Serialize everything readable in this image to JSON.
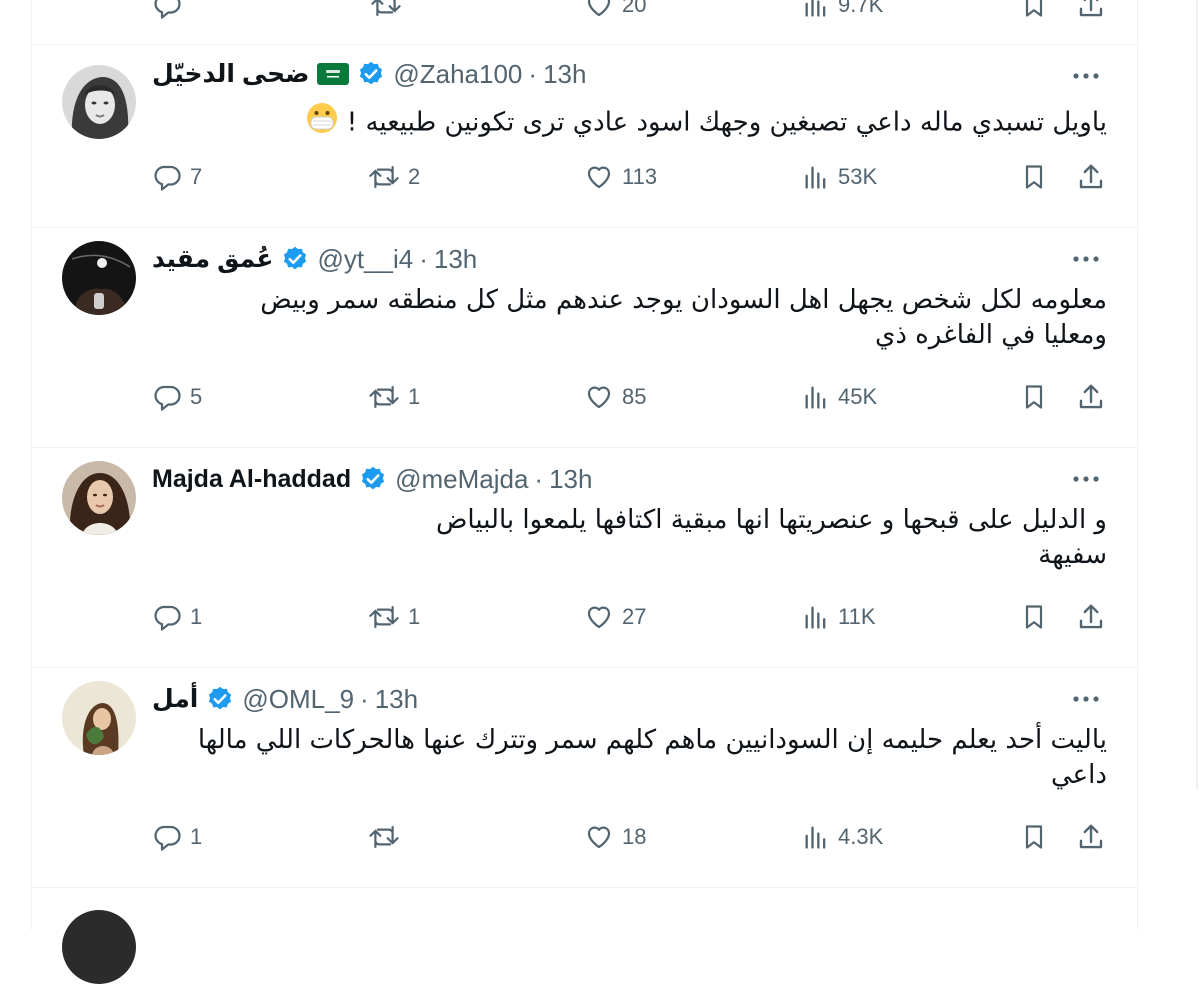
{
  "top_partial": {
    "like_count": "20",
    "views_count": "9.7K"
  },
  "tweets": [
    {
      "name": "ضحى الدخيّل",
      "has_flag": true,
      "handle": "@Zaha100",
      "time": "13h",
      "text": "ياويل تسبدي ماله داعي تصبغين وجهك اسود عادي ترى تكونين طبيعيه !",
      "emoji": "face-with-medical-mask",
      "replies": "7",
      "retweets": "2",
      "likes": "113",
      "views": "53K"
    },
    {
      "name": "عُمق مقيد",
      "has_flag": false,
      "handle": "@yt__i4",
      "time": "13h",
      "text_lines": [
        "معلومه  لكل شخص يجهل اهل السودان يوجد عندهم  مثل كل منطقه سمر وبيض",
        "ومعليا في الفاغره ذي"
      ],
      "replies": "5",
      "retweets": "1",
      "likes": "85",
      "views": "45K"
    },
    {
      "name": "Majda Al-haddad",
      "has_flag": false,
      "handle": "@meMajda",
      "time": "13h",
      "text_lines": [
        "و الدليل على قبحها و عنصريتها انها مبقية اكتافها يلمعوا بالبياض",
        "سفيهة"
      ],
      "replies": "1",
      "retweets": "1",
      "likes": "27",
      "views": "11K"
    },
    {
      "name": "أمل",
      "has_flag": false,
      "handle": "@OML_9",
      "time": "13h",
      "text_lines": [
        "ياليت أحد يعلم حليمه إن السودانيين ماهم كلهم سمر وتترك عنها هالحركات اللي مالها",
        "داعي"
      ],
      "replies": "1",
      "retweets": "",
      "likes": "18",
      "views": "4.3K"
    }
  ],
  "separator_dot": "·",
  "colors": {
    "text": "#0f1419",
    "muted": "#536471",
    "verified": "#1d9bf0",
    "border": "#eff3f4"
  }
}
